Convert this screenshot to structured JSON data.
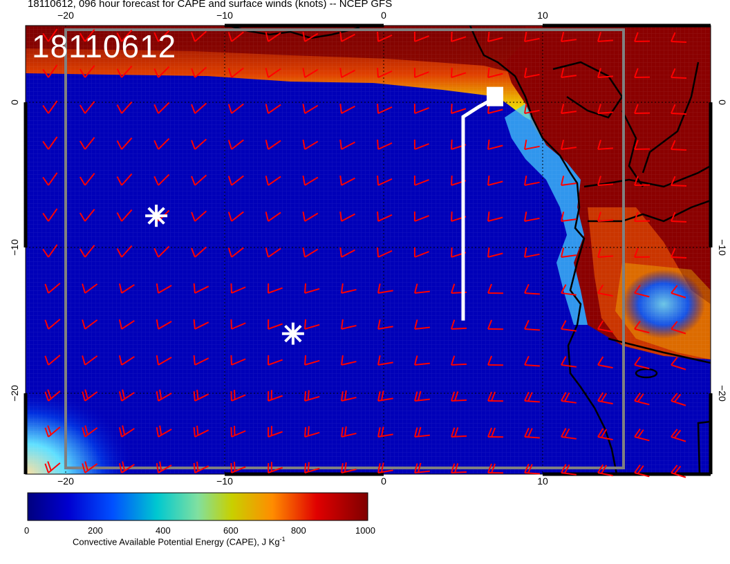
{
  "title": "18110612, 096 hour forecast for CAPE and surface winds (knots) -- NCEP GFS",
  "stamp": "18110612",
  "axes": {
    "lon_ticks": [
      "−20",
      "−10",
      "0",
      "10"
    ],
    "lat_ticks": [
      "0",
      "−10",
      "−20"
    ],
    "lon_range": [
      -22.5,
      21
    ],
    "lat_range": [
      -25,
      5
    ]
  },
  "colorbar": {
    "ticks": [
      "0",
      "200",
      "400",
      "600",
      "800",
      "1000"
    ],
    "caption_main": "Convective Available Potential Energy (CAPE), J Kg",
    "caption_sup": "-1",
    "range": [
      0,
      1000
    ],
    "colors": [
      "#00007f",
      "#0000d0",
      "#0050ff",
      "#00c8d0",
      "#80e0a0",
      "#c8d000",
      "#ff8c00",
      "#e00000",
      "#7f0000"
    ]
  },
  "markers": [
    {
      "type": "asterisk",
      "lon": -14.3,
      "lat": -7.8
    },
    {
      "type": "asterisk",
      "lon": -5.7,
      "lat": -15.9
    }
  ],
  "track": [
    {
      "lon": 5,
      "lat": -15
    },
    {
      "lon": 5,
      "lat": -1
    },
    {
      "lon": 6,
      "lat": -0.3
    },
    {
      "lon": 7,
      "lat": 0.3
    }
  ],
  "barb_color": "#ff0000"
}
